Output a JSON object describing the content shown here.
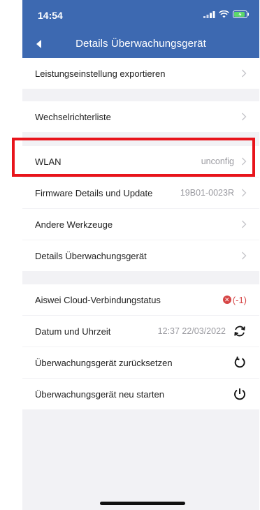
{
  "status_bar": {
    "time": "14:54"
  },
  "header": {
    "title": "Details Überwachungsgerät"
  },
  "rows": [
    {
      "label": "Leistungseinstellung exportieren"
    },
    {
      "label": "Wechselrichterliste"
    },
    {
      "label": "WLAN",
      "value": "unconfig"
    },
    {
      "label": "Firmware Details und Update",
      "value": "19B01-0023R"
    },
    {
      "label": "Andere Werkzeuge"
    },
    {
      "label": "Details Überwachungsgerät"
    },
    {
      "label": "Aiswei Cloud-Verbindungstatus",
      "value": "(-1)"
    },
    {
      "label": "Datum und Uhrzeit",
      "value": "12:37 22/03/2022"
    },
    {
      "label": "Überwachungsgerät zurücksetzen"
    },
    {
      "label": "Überwachungsgerät neu starten"
    }
  ],
  "colors": {
    "header": "#3d69b1",
    "error": "#d64545",
    "highlight": "#e8141b"
  },
  "icons": {
    "back": "back-arrow-icon",
    "chevron": "chevron-right-icon",
    "error": "error-x-icon",
    "sync": "sync-icon",
    "reset": "reset-icon",
    "power": "power-icon"
  }
}
